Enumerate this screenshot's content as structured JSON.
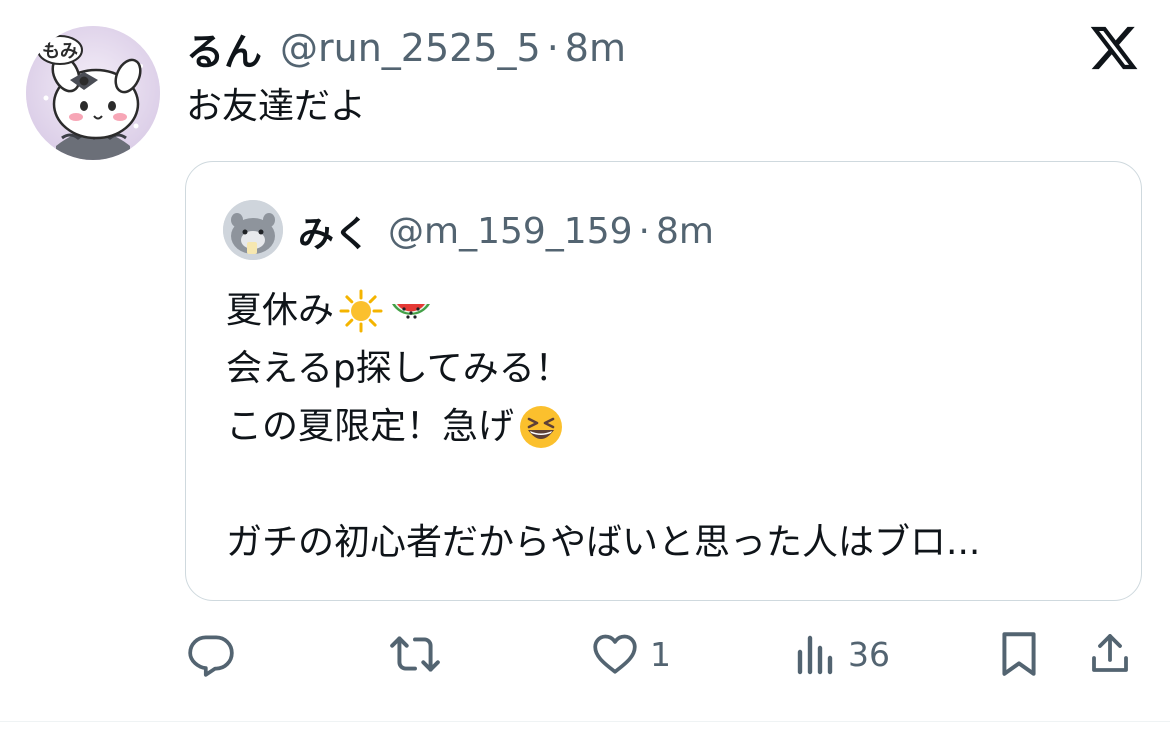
{
  "tweet": {
    "author": {
      "display_name": "るん",
      "handle": "@run_2525_5",
      "time": "8m",
      "avatar_icon": "user-avatar",
      "avatar_text": "もみ"
    },
    "text": "お友達だよ"
  },
  "quoted_tweet": {
    "author": {
      "display_name": "みく",
      "handle": "@m_159_159",
      "time": "8m",
      "avatar_icon": "user-avatar"
    },
    "lines": [
      {
        "text": "夏休み",
        "emoji": [
          "sun-emoji",
          "watermelon-emoji"
        ]
      },
      {
        "text": "会えるp探してみる！"
      },
      {
        "text": "この夏限定！急げ",
        "emoji": [
          "grinning-squint-emoji"
        ]
      },
      {
        "text": ""
      },
      {
        "text": "ガチの初心者だからやばいと思った人はブロ..."
      }
    ]
  },
  "actions": {
    "reply": {
      "icon": "reply-icon"
    },
    "retweet": {
      "icon": "retweet-icon"
    },
    "like": {
      "icon": "heart-icon",
      "count": "1"
    },
    "views": {
      "icon": "views-icon",
      "count": "36"
    },
    "bookmark": {
      "icon": "bookmark-icon"
    },
    "share": {
      "icon": "share-icon"
    }
  },
  "brand": {
    "logo_icon": "x-logo-icon"
  },
  "colors": {
    "text_primary": "#0f1419",
    "text_secondary": "#536471",
    "border": "#cfd9de",
    "emoji_yellow": "#fbc02d",
    "watermelon_green": "#43a047",
    "watermelon_red": "#e53935"
  }
}
